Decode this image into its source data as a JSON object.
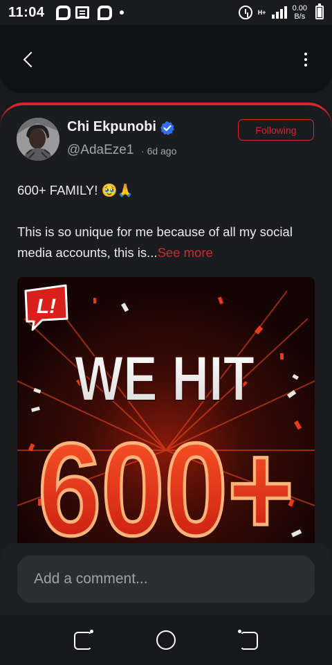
{
  "status_bar": {
    "time": "11:04",
    "network_type": "H+",
    "speed_value": "0.00",
    "speed_unit": "B/s",
    "notification_icons": [
      "p-app-icon",
      "news-icon",
      "p-app-icon",
      "dot-icon"
    ],
    "system_icons": [
      "alarm-icon",
      "signal-icon",
      "battery-icon"
    ]
  },
  "header": {
    "back_icon": "chevron-left-icon",
    "menu_icon": "more-vertical-icon"
  },
  "post": {
    "author_name": "Chi Ekpunobi",
    "author_handle": "@AdaEze1",
    "separator": "·",
    "time_ago": "6d ago",
    "follow_label": "Following",
    "text_line1": "600+ FAMILY! 🥹🙏",
    "text_body": "This is so unique for me because of all my social media accounts, this is...",
    "see_more": "See more",
    "image": {
      "badge": "L!",
      "headline": "WE HIT",
      "number": "600+"
    }
  },
  "comment": {
    "placeholder": "Add a comment..."
  },
  "colors": {
    "accent": "#d5262a",
    "background": "#18191c",
    "card": "#1b1c1f",
    "header": "#101114",
    "muted_text": "#a3a5ab",
    "verified": "#2f6fe8"
  }
}
